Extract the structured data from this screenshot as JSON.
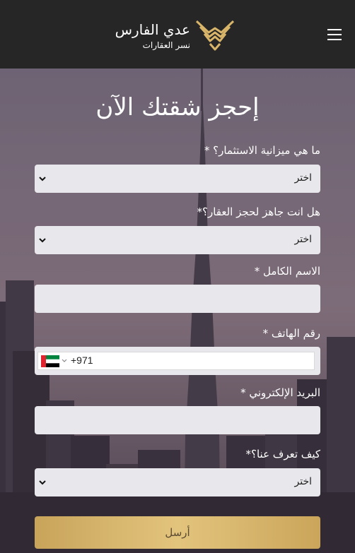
{
  "header": {
    "brand_title": "عدي الفارس",
    "brand_subtitle": "نسر العقارات",
    "menu_icon": "hamburger-menu-icon",
    "logo_icon": "eagle-wings-logo-icon",
    "brand_gold": "#d9b56a"
  },
  "form": {
    "title": "إحجز شقتك الآن",
    "budget_label": "ما هي ميزانية الاستثمار؟ *",
    "budget_value": "اختر",
    "ready_label": "هل انت جاهز لحجز العقار؟*",
    "ready_value": "اختر",
    "name_label": "الاسم الكامل *",
    "name_value": "",
    "phone_label": "رقم الهاتف *",
    "phone_country_flag": "uae-flag-icon",
    "phone_dial_code": "+971",
    "email_label": "البريد الإلكتروني *",
    "email_value": "",
    "source_label": "كيف تعرف عنا؟*",
    "source_value": "اختر",
    "submit_label": "أرسل",
    "submit_color": "#d8b66c"
  }
}
